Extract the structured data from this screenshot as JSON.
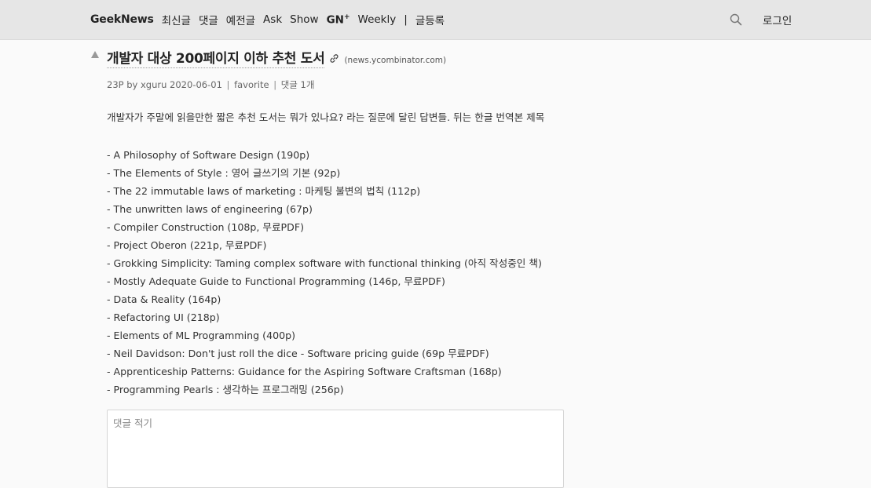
{
  "nav": {
    "brand": "GeekNews",
    "items": [
      "최신글",
      "댓글",
      "예전글",
      "Ask",
      "Show"
    ],
    "gn_label": "GN",
    "gn_sup": "+",
    "weekly": "Weekly",
    "divider": "|",
    "submit": "글등록",
    "login": "로그인"
  },
  "post": {
    "title": "개발자 대상 200페이지 이하 추천 도서",
    "domain": "(news.ycombinator.com)",
    "meta": {
      "points_by": "23P by xguru 2020-06-01",
      "favorite": "favorite",
      "comments": "댓글 1개",
      "separator": "|"
    },
    "intro": "개발자가 주말에 읽을만한 짧은 추천 도서는 뭐가 있나요? 라는 질문에 달린 답변들. 뒤는 한글 번역본 제목",
    "books": [
      "- A Philosophy of Software Design (190p)",
      "- The Elements of Style : 영어 글쓰기의 기본 (92p)",
      "- The 22 immutable laws of marketing : 마케팅 불변의 법칙 (112p)",
      "- The unwritten laws of engineering (67p)",
      "- Compiler Construction (108p, 무료PDF)",
      "- Project Oberon (221p, 무료PDF)",
      "- Grokking Simplicity: Taming complex software with functional thinking (아직 작성중인 책)",
      "- Mostly Adequate Guide to Functional Programming (146p, 무료PDF)",
      "- Data & Reality (164p)",
      "- Refactoring UI (218p)",
      "- Elements of ML Programming (400p)",
      "- Neil Davidson: Don't just roll the dice - Software pricing guide (69p 무료PDF)",
      "- Apprenticeship Patterns: Guidance for the Aspiring Software Craftsman (168p)",
      "- Programming Pearls : 생각하는 프로그래밍 (256p)"
    ]
  },
  "comment": {
    "placeholder": "댓글 적기"
  },
  "icons": {
    "search": "search-icon",
    "link": "link-icon",
    "upvote": "upvote-icon"
  }
}
